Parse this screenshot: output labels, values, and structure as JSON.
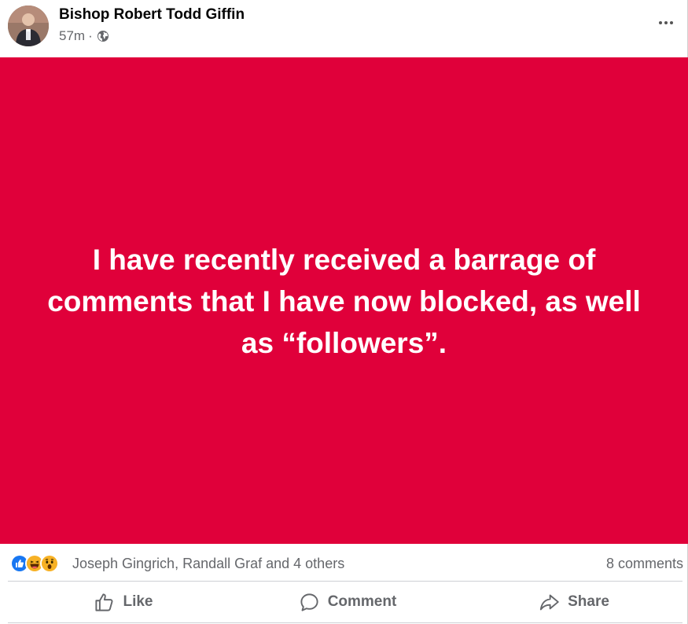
{
  "header": {
    "author_name": "Bishop Robert Todd Giffin",
    "timestamp": "57m",
    "separator": "·",
    "audience_icon": "globe-icon",
    "more_icon": "more-horizontal-icon"
  },
  "post": {
    "text": "I have recently received a barrage of comments that I have now blocked, as well as “followers”.",
    "background_color": "#e0003a",
    "text_color": "#ffffff"
  },
  "reactions": {
    "icons": [
      "like-reaction-icon",
      "haha-reaction-icon",
      "wow-reaction-icon"
    ],
    "names_text": "Joseph Gingrich, Randall Graf and 4 others",
    "comments_text": "8 comments"
  },
  "actions": {
    "like_label": "Like",
    "comment_label": "Comment",
    "share_label": "Share"
  }
}
